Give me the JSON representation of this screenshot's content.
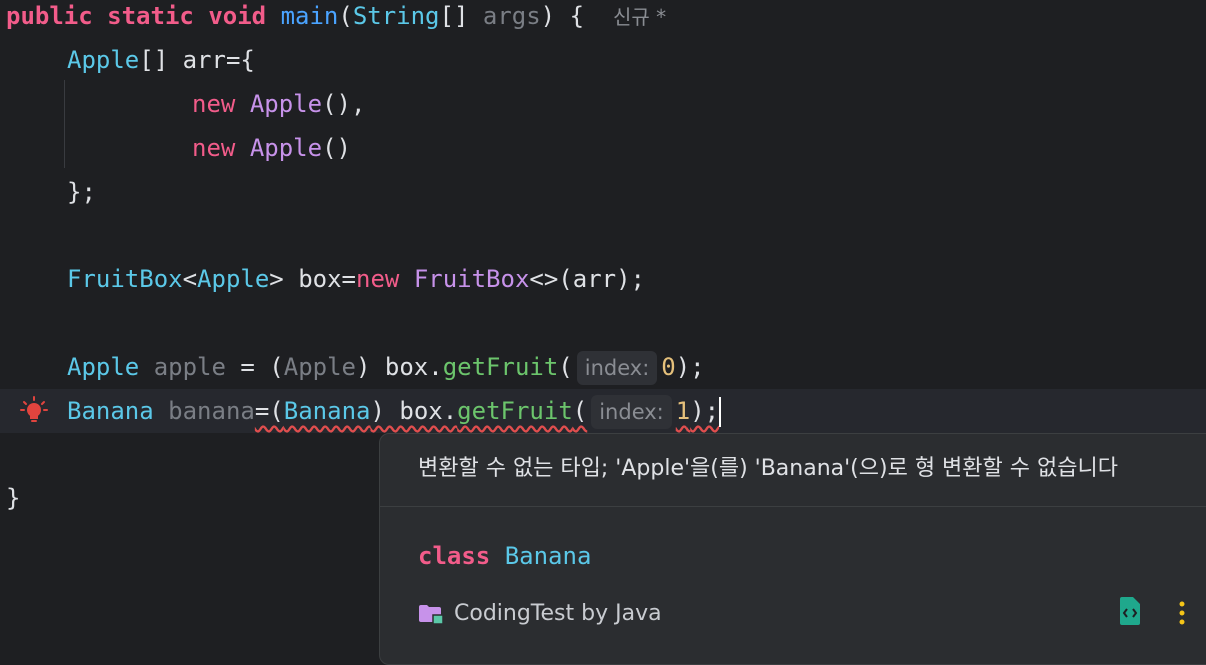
{
  "code": {
    "l1": {
      "kw1": "public",
      "kw2": "static",
      "kw3": "void",
      "fn": "main",
      "p1": "(",
      "ty": "String",
      "p2": "[] ",
      "arg": "args",
      "p3": ") {",
      "tag": "신규 *"
    },
    "l2": {
      "ty": "Apple",
      "rest": "[] arr={"
    },
    "l3": {
      "kw": "new",
      "ty": "Apple",
      "rest": "(),"
    },
    "l4": {
      "kw": "new",
      "ty": "Apple",
      "rest": "()"
    },
    "l5": {
      "text": "};"
    },
    "l6": {
      "ty1": "FruitBox",
      "lt": "<",
      "ty2": "Apple",
      "gt": "> box=",
      "kw": "new",
      "sp": " ",
      "ty3": "FruitBox",
      "rest": "<>(arr);"
    },
    "l7": {
      "ty": "Apple",
      "var": "apple",
      "eq": " = (",
      "cast": "Apple",
      "close": ") box.",
      "call": "getFruit",
      "paren": "(",
      "hint": "index:",
      "num": "0",
      "end": ");"
    },
    "l8": {
      "ty": "Banana",
      "var": "banana",
      "eq": "=(",
      "cast": "Banana",
      "close": ") box.",
      "call": "getFruit",
      "paren": "(",
      "hint": "index:",
      "num": "1",
      "end": ");"
    },
    "l9": {
      "text": "}"
    }
  },
  "popup": {
    "message": "변환할 수 없는 타입; 'Apple'을(를) 'Banana'(으)로 형 변환할 수 없습니다",
    "class_kw": "class",
    "class_name": "Banana",
    "project": "CodingTest by Java"
  },
  "icons": {
    "bulb": "lightbulb-error-icon",
    "folder": "module-folder-icon",
    "file": "java-file-icon",
    "more": "more-vertical-icon"
  },
  "colors": {
    "keyword": "#f25c8a",
    "type": "#5bc8e8",
    "method": "#6cc56c",
    "number": "#e5c07b",
    "error": "#e04e4e"
  }
}
